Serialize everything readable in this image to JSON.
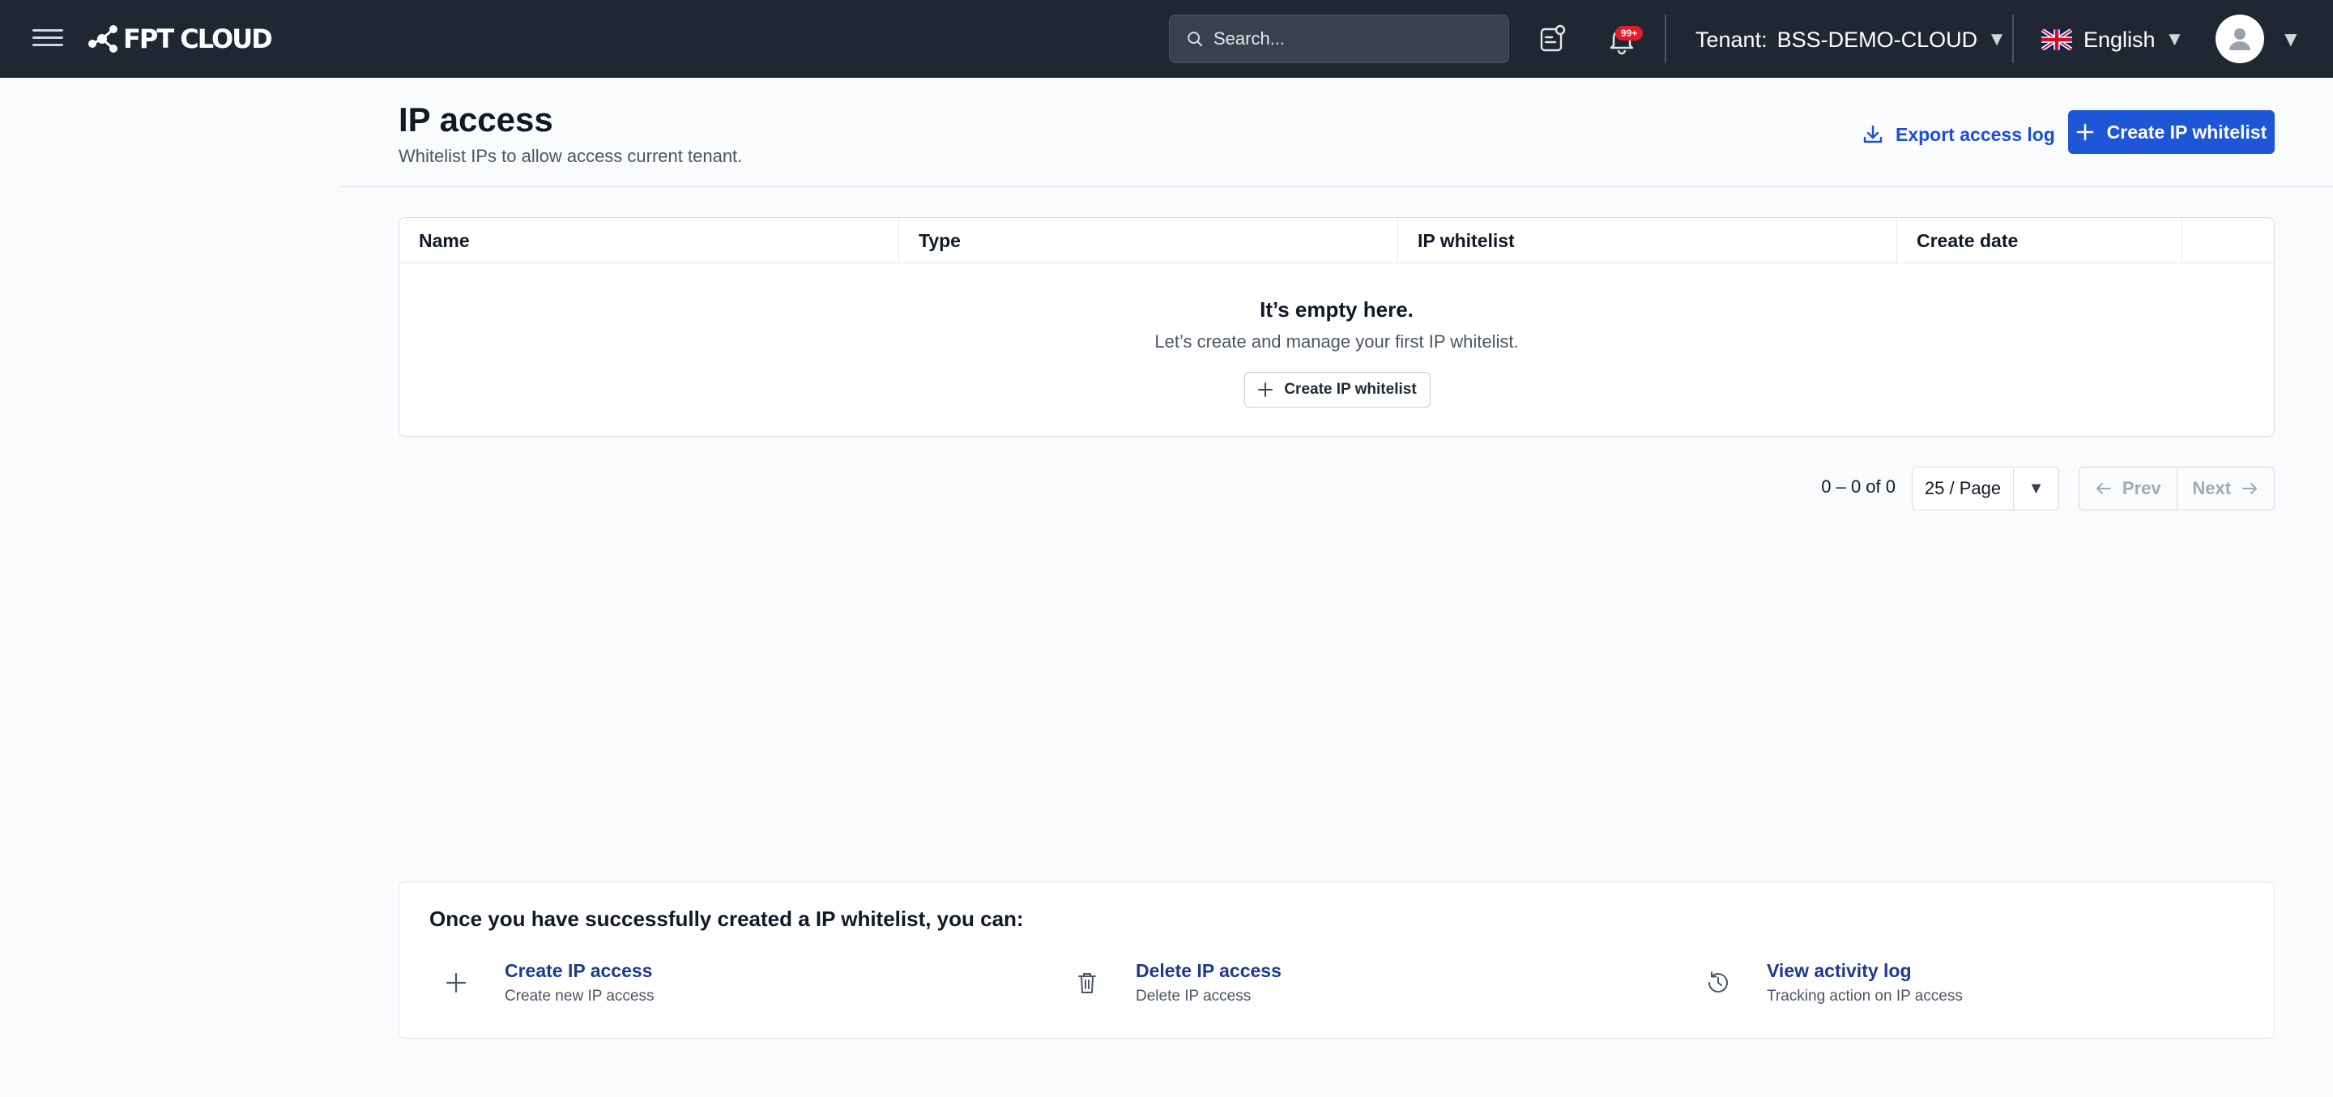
{
  "topbar": {
    "brand": "FPT CLOUD",
    "search_placeholder": "Search...",
    "notification_badge": "99+",
    "tenant_label": "Tenant:",
    "tenant_value": "BSS-DEMO-CLOUD",
    "language": "English",
    "icons": {
      "menu": "hamburger-icon",
      "search": "search-icon",
      "tasks": "task-list-icon",
      "notifications": "bell-icon",
      "flag": "uk-flag-icon",
      "user": "user-avatar-icon"
    }
  },
  "header": {
    "title": "IP access",
    "subtitle": "Whitelist IPs to allow access current tenant.",
    "export_label": "Export access log",
    "create_label": "Create IP whitelist"
  },
  "table": {
    "columns": [
      "Name",
      "Type",
      "IP whitelist",
      "Create date",
      ""
    ],
    "rows": [],
    "empty_title": "It’s empty here.",
    "empty_subtitle": "Let’s create and manage your first IP whitelist.",
    "empty_button": "Create IP whitelist"
  },
  "pagination": {
    "count": "0 – 0 of 0",
    "page_size": "25 / Page",
    "prev": "Prev",
    "next": "Next"
  },
  "info_card": {
    "title": "Once you have successfully created a IP whitelist, you can:",
    "actions": [
      {
        "title": "Create IP access",
        "desc": "Create new IP access",
        "icon": "plus-icon"
      },
      {
        "title": "Delete IP access",
        "desc": "Delete IP access",
        "icon": "trash-icon"
      },
      {
        "title": "View activity log",
        "desc": "Tracking action on IP access",
        "icon": "history-icon"
      }
    ]
  },
  "colors": {
    "topbar_bg": "#1f2733",
    "primary": "#1e56d6",
    "link": "#1d4ed8",
    "badge": "#e11d2a",
    "page_bg": "#fafbfc"
  }
}
